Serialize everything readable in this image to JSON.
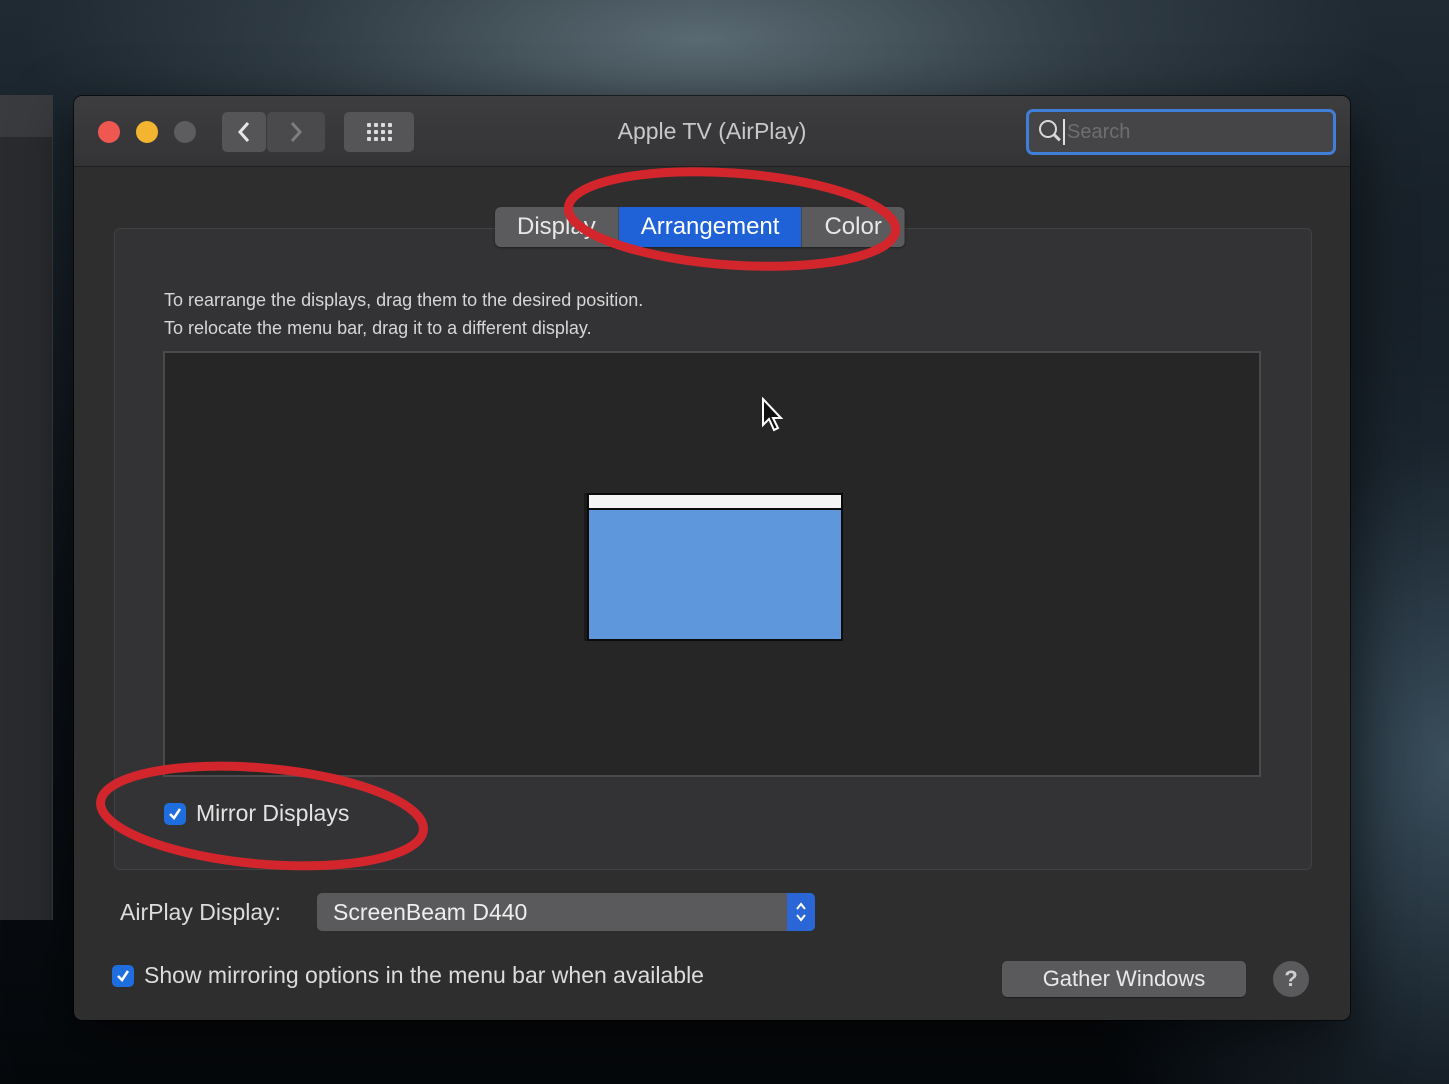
{
  "window": {
    "title": "Apple TV (AirPlay)",
    "search_placeholder": "Search"
  },
  "tabs": [
    {
      "label": "Display",
      "active": false
    },
    {
      "label": "Arrangement",
      "active": true
    },
    {
      "label": "Color",
      "active": false
    }
  ],
  "instructions": {
    "line1": "To rearrange the displays, drag them to the desired position.",
    "line2": "To relocate the menu bar, drag it to a different display."
  },
  "mirror_displays": {
    "label": "Mirror Displays",
    "checked": true
  },
  "airplay": {
    "label": "AirPlay Display:",
    "selected": "ScreenBeam D440"
  },
  "show_mirroring": {
    "label": "Show mirroring options in the menu bar when available",
    "checked": true
  },
  "gather_windows_label": "Gather Windows",
  "help_label": "?",
  "icons": {
    "back": "chevron-left-icon",
    "forward": "chevron-right-icon",
    "grid": "grid-icon",
    "search": "search-icon",
    "help": "help-icon",
    "cursor": "mouse-pointer-icon"
  },
  "colors": {
    "accent": "#1f62d8",
    "annotation": "#d3262c",
    "display_thumbnail": "#5e97dc"
  }
}
